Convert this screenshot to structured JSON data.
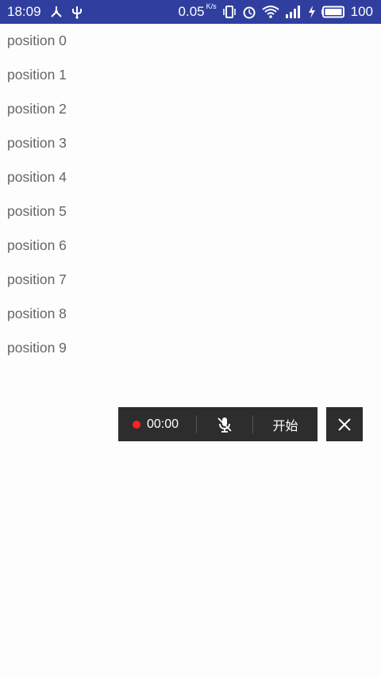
{
  "status_bar": {
    "time": "18:09",
    "net_speed": "0.05",
    "net_speed_unit": "K/s",
    "battery": "100",
    "left_icons": [
      "share-hub-icon",
      "usb-icon"
    ],
    "right_icons": [
      "vibrate-icon",
      "alarm-icon",
      "wifi-icon",
      "signal-icon",
      "charging-icon",
      "battery-icon"
    ]
  },
  "list": {
    "items": [
      "position 0",
      "position 1",
      "position 2",
      "position 3",
      "position 4",
      "position 5",
      "position 6",
      "position 7",
      "position 8",
      "position 9"
    ]
  },
  "recorder": {
    "time": "00:00",
    "start_label": "开始",
    "icons": [
      "record-dot-icon",
      "mic-muted-icon",
      "close-icon"
    ],
    "colors": {
      "toolbar_bg": "#2d2d2d",
      "record_dot": "#ff2020"
    }
  },
  "colors": {
    "status_bar": "#303f9f",
    "background": "#fdfdfd",
    "list_text": "#666666"
  }
}
